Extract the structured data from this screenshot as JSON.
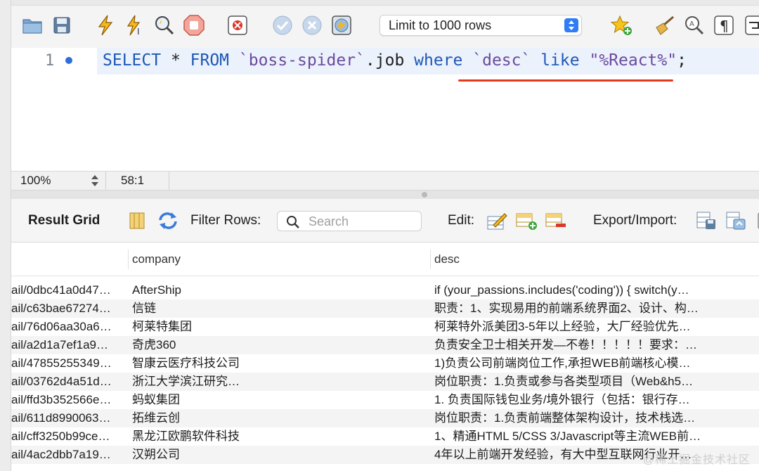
{
  "toolbar": {
    "limit_select": "Limit to 1000 rows"
  },
  "editor": {
    "line_number": "1",
    "sql": {
      "t1": "SELECT",
      "t2": " * ",
      "t3": "FROM",
      "t4": " ",
      "t5": "`boss-spider`",
      "t6": ".job ",
      "t7": "where",
      "t8": " ",
      "t9": "`desc`",
      "t10": " ",
      "t11": "like",
      "t12": " ",
      "t13": "\"%React%\"",
      "t14": ";"
    }
  },
  "status": {
    "zoom": "100%",
    "cursor": "58:1"
  },
  "results": {
    "title": "Result Grid",
    "filter_label": "Filter Rows:",
    "search_placeholder": "Search",
    "edit_label": "Edit:",
    "export_label": "Export/Import:",
    "columns": [
      "company",
      "desc"
    ],
    "rows": [
      [
        "ail/0dbc41a0d47…",
        "AfterShip",
        "if (your_passions.includes('coding')) {    switch(y…"
      ],
      [
        "ail/c63bae67274…",
        "信链",
        "职责：1、实现易用的前端系统界面2、设计、构…"
      ],
      [
        "ail/76d06aa30a6…",
        "柯莱特集团",
        "柯莱特外派美团3-5年以上经验，大厂经验优先…"
      ],
      [
        "ail/a2d1a7ef1a9…",
        "奇虎360",
        "负责安全卫士相关开发—不卷！！！！！要求：…"
      ],
      [
        "ail/47855255349…",
        "智康云医疗科技公司",
        "1)负责公司前端岗位工作,承担WEB前端核心模…"
      ],
      [
        "ail/03762d4a51d…",
        "浙江大学滨江研究…",
        "岗位职责：1.负责或参与各类型项目（Web&h5…"
      ],
      [
        "ail/ffd3b352566e…",
        "蚂蚁集团",
        "1. 负责国际钱包业务/境外银行（包括：银行存…"
      ],
      [
        "ail/611d8990063…",
        "拓维云创",
        "岗位职责：1.负责前端整体架构设计，技术栈选…"
      ],
      [
        "ail/cff3250b99ce…",
        "黑龙江欧鹏软件科技",
        "1、精通HTML 5/CSS 3/Javascript等主流WEB前…"
      ],
      [
        "ail/4ac2dbb7a19…",
        "汉朔公司",
        "4年以上前端开发经验，有大中型互联网行业开…"
      ]
    ]
  },
  "watermark": "@稀土掘金技术社区",
  "colors": {
    "keyword": "#1d58b6",
    "identifier": "#6b4aa0",
    "underline": "#e03a1f",
    "select_accent": "#2f7cf6"
  }
}
